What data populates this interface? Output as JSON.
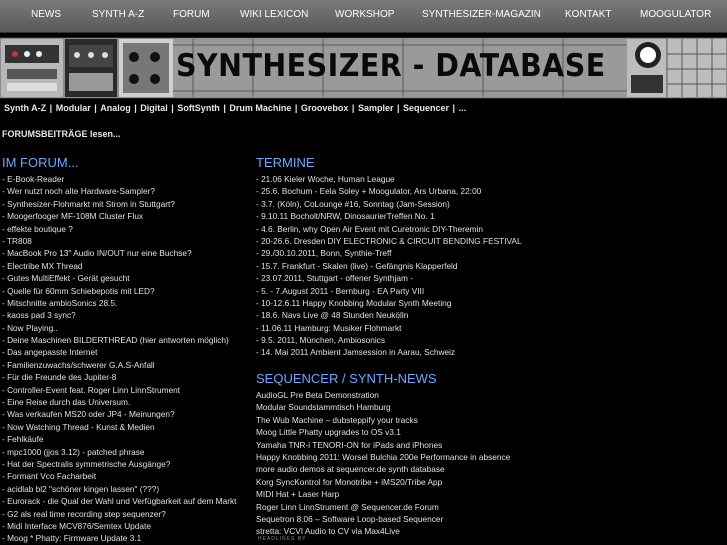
{
  "nav": {
    "items": [
      "NEWS",
      "SYNTH A-Z",
      "FORUM",
      "WIKI LEXICON",
      "WORKSHOP",
      "SYNTHESIZER-MAGAZIN",
      "KONTAKT",
      "MOOGULATOR"
    ]
  },
  "banner": {
    "title": "SYNTHESIZER - DATABASE"
  },
  "categories": [
    "Synth A-Z",
    "Modular",
    "Analog",
    "Digital",
    "SoftSynth",
    "Drum Machine",
    "Groovebox",
    "Sampler",
    "Sequencer",
    "..."
  ],
  "forum_link": "FORUMSBEITRÄGE lesen...",
  "forum": {
    "heading": "IM FORUM...",
    "items": [
      "- E-Book-Reader",
      "- Wer nutzt noch alte Hardware-Sampler?",
      "- Synthesizer-Flohmarkt mit Strom in Stuttgart?",
      "- Moogerfooger MF-108M Cluster Flux",
      "- effekte boutique ?",
      "- TR808",
      "- MacBook Pro 13\" Audio IN/OUT nur eine Buchse?",
      "- Electribe MX Thread",
      "- Gutes MultiEffekt - Gerät gesucht",
      "- Quelle für 60mm Schiebepotis mit LED?",
      "- Mitschnitte ambioSonics 28.5.",
      "- kaoss pad 3 sync?",
      "- Now Playing..",
      "- Deine Maschinen BILDERTHREAD (hier antworten möglich)",
      "- Das angepasste Internet",
      "- Familienzuwachs/schwerer G.A.S-Anfall",
      "- Für die Freunde des Jupiter-8",
      "- Controller-Event feat. Roger Linn LinnStrument",
      "- Eine Reise durch das Universum.",
      "- Was verkaufen MS20 oder JP4 - Meinungen?",
      "- Now Watching Thread - Kunst & Medien",
      "- Fehlkäufe",
      "- mpc1000 (jjos 3.12) - patched phrase",
      "- Hat der Spectralis symmetrische Ausgänge?",
      "- Formant Vco Facharbeit",
      "- acidlab bl2 \"schöner kingen lassen\" (???)",
      "- Eurorack - die Qual der Wahl und Verfügbarkeit auf dem Markt",
      "- G2 als real time recording step sequenzer?",
      "- Midi Interface MCV876/Semtex Update",
      "- Moog * Phatty: Firmware Update 3.1"
    ]
  },
  "termine": {
    "heading": "TERMINE",
    "items": [
      "- 21.06 Kieler Woche, Human League",
      "- 25.6. Bochum - Eela Soley + Moogulator, Ars Urbana, 22:00",
      "- 3.7. (Köln), CoLounge #16, Sonntag (Jam-Session)",
      "- 9.10.11 Bocholt/NRW, DinosaurierTreffen No. 1",
      "- 4.6. Berlin, why Open Air Event mit Curetronic DIY-Theremin",
      "- 20-26.6. Dresden DIY ELECTRONIC & CIRCUIT BENDING FESTIVAL",
      "- 29./30.10.2011, Bonn, Synthie-Treff",
      "- 15.7. Frankfurt - Skalen (live) - Gefängnis Klapperfeld",
      "- 23.07.2011, Stuttgart - offener Synthjam -",
      "- 5. - 7.August 2011 - Bernburg - EA Party VIII",
      "- 10-12.6.11 Happy Knobbing Modular Synth Meeting",
      "- 18.6. Navs Live @ 48 Stunden Neukölln",
      "- 11.06.11 Hamburg: Musiker Flohmarkt",
      "- 9.5. 2011, München, Ambiosonics",
      "- 14. Mai 2011 Ambient Jamsession in Aarau, Schweiz"
    ]
  },
  "news": {
    "heading": "SEQUENCER / SYNTH-NEWS",
    "items": [
      "AudioGL Pre Beta Demonstration",
      "Modular Soundstammtisch Hamburg",
      "The Wub Machine – dubsteppify your tracks",
      "Moog Little Phatty upgrades to OS v3.1",
      "Yamaha TNR-i TENORI-ON for iPads and iPhones",
      "Happy Knobbing 2011: Worsel Bulchia 200e Performance in absence",
      "more audio demos at sequencer.de synth database",
      "Korg SyncKontrol for Monotribe + iMS20/Tribe App",
      "MIDI Hat + Laser Harp",
      "Roger Linn LinnStrument @ Sequencer.de Forum",
      "Sequetron 8.06 – Software Loop-based Sequencer",
      "stretta: VCVI Audio to CV via Max4Live"
    ]
  },
  "footer": {
    "headlines_logo": "HEADLINES BY"
  },
  "colors": {
    "background": "#000000",
    "heading": "#6fa6ff",
    "nav_bg": "#6a6a6a"
  }
}
